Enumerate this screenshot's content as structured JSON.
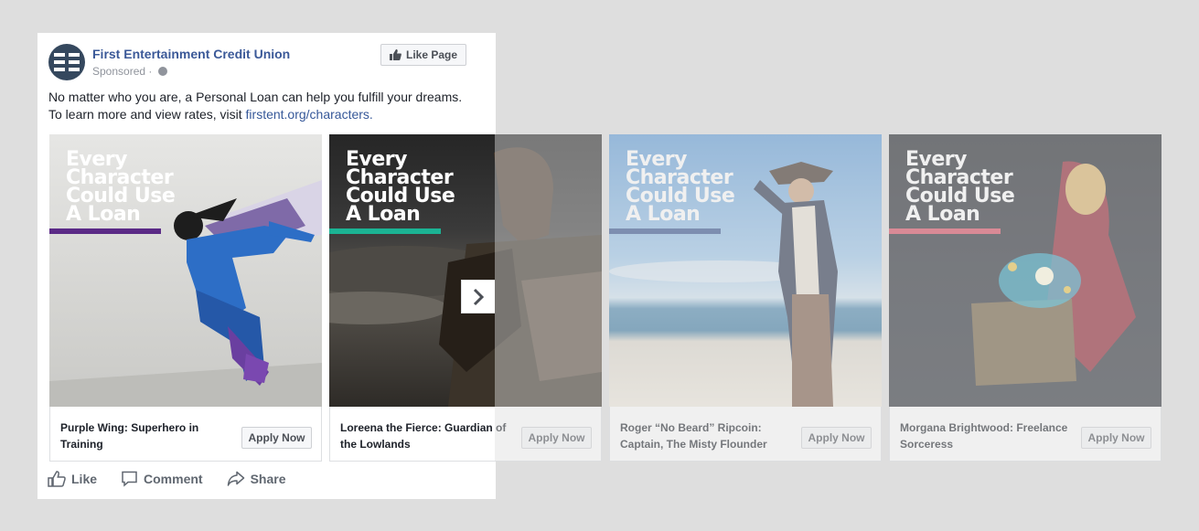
{
  "post": {
    "page_name": "First Entertainment Credit Union",
    "sponsored": "Sponsored ·",
    "like_page_label": "Like Page",
    "text_line1": "No matter who you are, a Personal Loan can help you fulfill your dreams.",
    "text_line2_prefix": "To learn more and view rates, visit ",
    "text_link": "firstent.org/characters."
  },
  "carousel": {
    "headline": [
      "Every",
      "Character",
      "Could Use",
      "A Loan"
    ],
    "cards": [
      {
        "caption_line1": "Purple Wing: Superhero in",
        "caption_line2": "Training",
        "cta": "Apply Now",
        "accent": "#5b2a86"
      },
      {
        "caption_line1": "Loreena the Fierce: Guardian of",
        "caption_line2": "the Lowlands",
        "cta": "Apply Now",
        "accent": "#1bb394"
      },
      {
        "caption_line1": "Roger “No Beard” Ripcoin:",
        "caption_line2": "Captain, The Misty Flounder",
        "cta": "Apply Now",
        "accent": "#2f4d8a"
      },
      {
        "caption_line1": "Morgana Brightwood: Freelance",
        "caption_line2": "Sorceress",
        "cta": "Apply Now",
        "accent": "#d6455c"
      }
    ]
  },
  "actions": {
    "like": "Like",
    "comment": "Comment",
    "share": "Share"
  },
  "icons": {
    "next": "chevron-right-icon",
    "like": "thumbs-up-icon",
    "comment": "comment-bubble-icon",
    "share": "share-arrow-icon",
    "audience": "globe-icon"
  }
}
